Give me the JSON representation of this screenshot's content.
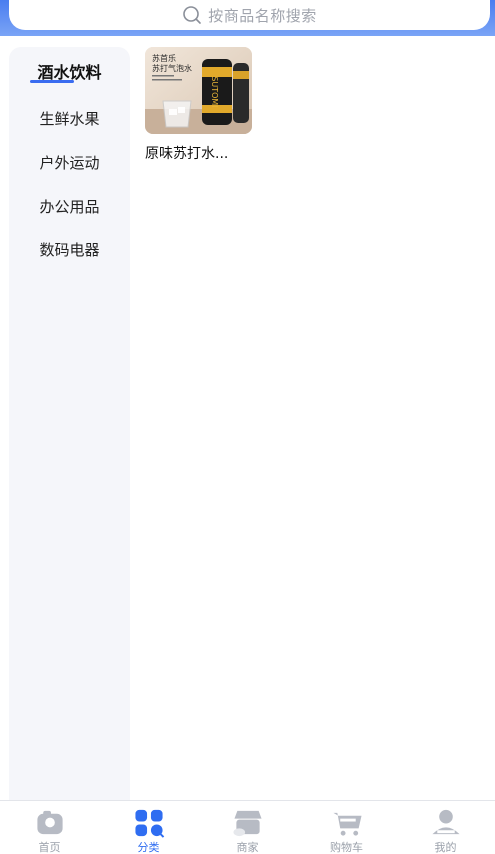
{
  "search": {
    "placeholder": "按商品名称搜索"
  },
  "sidebar": {
    "items": [
      {
        "label": "酒水饮料",
        "active": true
      },
      {
        "label": "生鲜水果",
        "active": false
      },
      {
        "label": "户外运动",
        "active": false
      },
      {
        "label": "办公用品",
        "active": false
      },
      {
        "label": "数码电器",
        "active": false
      }
    ]
  },
  "products": [
    {
      "name": "原味苏打水...",
      "image": {
        "line1": "苏首乐",
        "line2": "苏打气泡水",
        "can_text": "SUTOMI"
      }
    }
  ],
  "tabbar": {
    "tabs": [
      {
        "label": "首页",
        "icon": "home-icon",
        "active": false
      },
      {
        "label": "分类",
        "icon": "category-icon",
        "active": true
      },
      {
        "label": "商家",
        "icon": "store-icon",
        "active": false
      },
      {
        "label": "购物车",
        "icon": "cart-icon",
        "active": false
      },
      {
        "label": "我的",
        "icon": "user-icon",
        "active": false
      }
    ]
  },
  "colors": {
    "accent": "#2f6df1",
    "header_gradient_top": "#4a7df0",
    "sidebar_bg": "#f5f6fa",
    "inactive_tab": "#9aa0aa"
  }
}
